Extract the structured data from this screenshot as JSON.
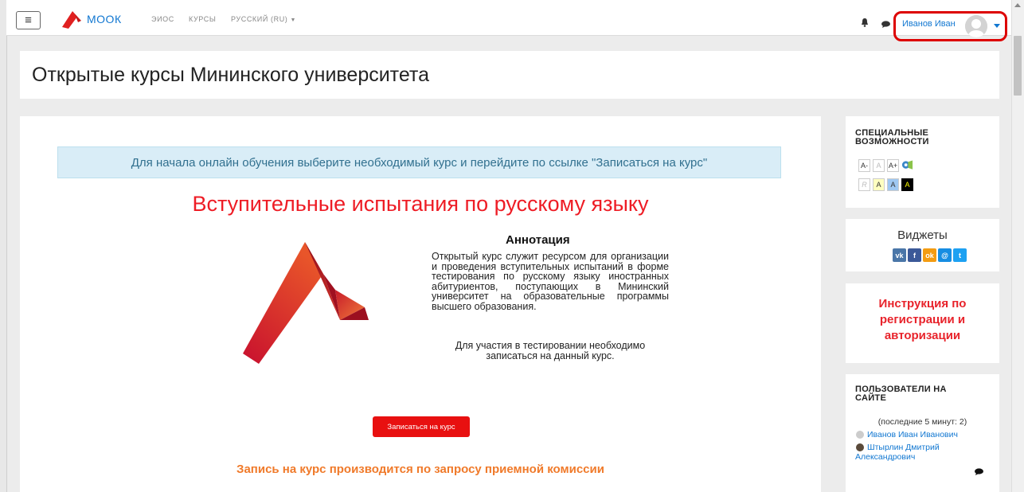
{
  "navbar": {
    "brand": "МООК",
    "links": [
      "ЭИОС",
      "КУРСЫ",
      "РУССКИЙ (RU)"
    ],
    "user_name": "Иванов Иван",
    "icons": [
      "menu-icon",
      "bell-icon",
      "chat-icon",
      "avatar",
      "chevron-down-icon"
    ]
  },
  "header": {
    "title": "Открытые курсы Мининского университета"
  },
  "main": {
    "notice": "Для начала онлайн обучения выберите необходимый курс и перейдите по ссылке \"Записаться на курс\"",
    "course_title": "Вступительные испытания по русскому языку",
    "annotation_title": "Аннотация",
    "annotation_text": "Открытый курс служит ресурсом для организации и проведения вступительных испытаний в форме тестирования по русскому языку иностранных абитуриентов, поступающих в Мининский университет на образовательные программы высшего образования.",
    "annotation_note": "Для участия в тестировании необходимо записаться на данный курс.",
    "enroll_button": "Записаться на курс",
    "enroll_note": "Запись на курс производится по запросу приемной комиссии"
  },
  "sidebar": {
    "accessibility": {
      "title": "СПЕЦИАЛЬНЫЕ ВОЗМОЖНОСТИ",
      "font_buttons": [
        "A-",
        "A",
        "A+"
      ],
      "color_buttons": [
        "R",
        "A",
        "A",
        "A"
      ]
    },
    "widgets": {
      "title": "Виджеты",
      "icons": [
        "vk-icon",
        "facebook-icon",
        "odnoklassniki-icon",
        "moimir-icon",
        "twitter-icon"
      ]
    },
    "instruction": {
      "label": "Инструкция по регистрации и авторизации"
    },
    "online_users": {
      "title": "ПОЛЬЗОВАТЕЛИ НА САЙТЕ",
      "subtitle": "(последние 5 минут: 2)",
      "users": [
        "Иванов Иван Иванович",
        "Штырлин Дмитрий Александрович"
      ]
    }
  },
  "colors": {
    "accent": "#1177d1",
    "brand_red": "#ee1c25",
    "enroll_note": "#f07a2a",
    "highlight_border": "#dd0000"
  }
}
